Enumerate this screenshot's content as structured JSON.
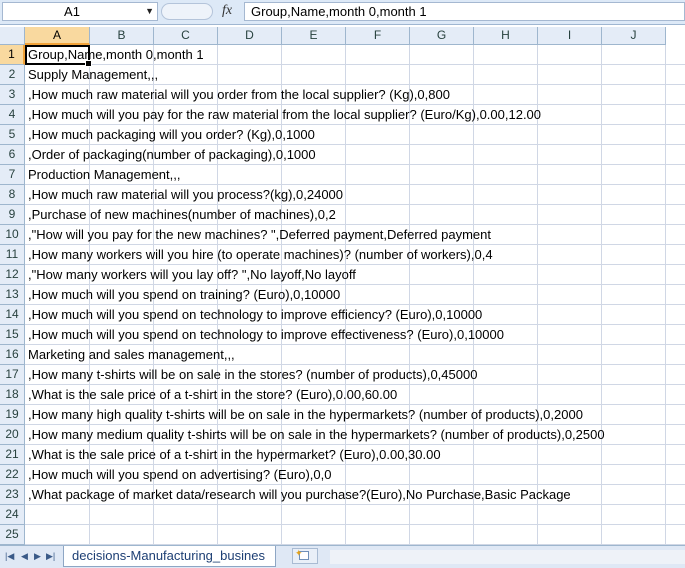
{
  "formula_bar": {
    "name_box": "A1",
    "fx_label": "fx",
    "formula": "Group,Name,month 0,month 1"
  },
  "columns": [
    "A",
    "B",
    "C",
    "D",
    "E",
    "F",
    "G",
    "H",
    "I",
    "J"
  ],
  "rows": [
    {
      "n": "1",
      "text": "Group,Name,month 0,month 1"
    },
    {
      "n": "2",
      "text": "Supply Management,,,"
    },
    {
      "n": "3",
      "text": ",How much raw material will you order from the local supplier? (Kg),0,800"
    },
    {
      "n": "4",
      "text": ",How much will you pay for the raw material from the local supplier? (Euro/Kg),0.00,12.00"
    },
    {
      "n": "5",
      "text": ",How much packaging will you order? (Kg),0,1000"
    },
    {
      "n": "6",
      "text": ",Order of packaging(number of packaging),0,1000"
    },
    {
      "n": "7",
      "text": "Production Management,,,"
    },
    {
      "n": "8",
      "text": ",How much raw material will you process?(kg),0,24000"
    },
    {
      "n": "9",
      "text": ",Purchase of new machines(number of machines),0,2"
    },
    {
      "n": "10",
      "text": ",\"How will you pay for the new machines? \",Deferred payment,Deferred payment"
    },
    {
      "n": "11",
      "text": ",How many workers will you hire (to operate machines)? (number of workers),0,4"
    },
    {
      "n": "12",
      "text": ",\"How many workers will you lay off? \",No layoff,No layoff"
    },
    {
      "n": "13",
      "text": ",How much will you spend on training? (Euro),0,10000"
    },
    {
      "n": "14",
      "text": ",How much will you spend on technology to improve efficiency? (Euro),0,10000"
    },
    {
      "n": "15",
      "text": ",How much will you spend on technology to improve effectiveness? (Euro),0,10000"
    },
    {
      "n": "16",
      "text": "Marketing and sales management,,,"
    },
    {
      "n": "17",
      "text": ",How many t-shirts will be on sale in the stores? (number of products),0,45000"
    },
    {
      "n": "18",
      "text": ",What is the sale price of a t-shirt in the store? (Euro),0.00,60.00"
    },
    {
      "n": "19",
      "text": ",How many high quality t-shirts will be on sale in the hypermarkets? (number of products),0,2000"
    },
    {
      "n": "20",
      "text": ",How many medium quality t-shirts will be on sale in the hypermarkets? (number of products),0,2500"
    },
    {
      "n": "21",
      "text": ",What is the sale price of a t-shirt in the hypermarket? (Euro),0.00,30.00"
    },
    {
      "n": "22",
      "text": ",How much will you spend on advertising? (Euro),0,0"
    },
    {
      "n": "23",
      "text": ",What package of market data/research will you purchase?(Euro),No Purchase,Basic Package"
    },
    {
      "n": "24",
      "text": ""
    },
    {
      "n": "25",
      "text": ""
    }
  ],
  "sheet_tab": "decisions-Manufacturing_busines",
  "icons": [
    "dropdown-arrow-icon",
    "function-icon",
    "nav-first-icon",
    "nav-prev-icon",
    "nav-next-icon",
    "nav-last-icon",
    "insert-sheet-icon"
  ]
}
